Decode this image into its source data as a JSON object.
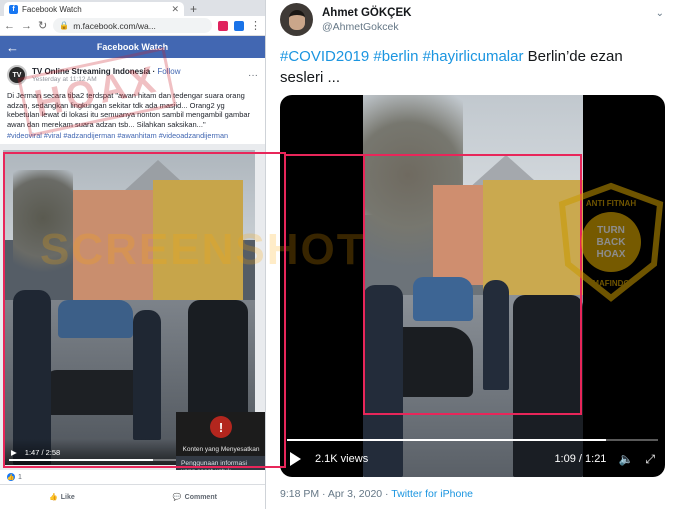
{
  "facebook": {
    "tab_title": "Facebook Watch",
    "url": "m.facebook.com/wa...",
    "header_title": "Facebook Watch",
    "post": {
      "page_name": "TV Online Streaming Indonesia",
      "follow_label": "Follow",
      "timestamp": "Yesterday at 11:12 AM",
      "text": "Di Jerman secara tiba2 terdspat \"awan hitam dan tedengar suara orang adzan, sedangkan lingkungan sekitar tdk ada masjid... Orang2 yg kebetulan lewat di lokasi itu semuanya nonton sambil mengambil gambar awan dan merekam suara adzan tsb... Silahkan saksikan...\"",
      "hashtags": "#videoviral #viral #adzandijerman #awanhitam #videoadzandijerman"
    },
    "video": {
      "time": "1:47 / 2:58",
      "progress": 0.6
    },
    "warning": {
      "title": "Konten yang Menyesatkan",
      "description": "Penggunaan informasi yang sesat untuk membingkai sebuah isu atau individu"
    },
    "reactions_count": "1",
    "like_label": "Like",
    "comment_label": "Comment"
  },
  "tweet": {
    "name": "Ahmet GÖKÇEK",
    "handle": "@AhmetGokcek",
    "hashtags": "#COVID2019 #berlin #hayirlicumalar",
    "text": " Berlin’de ezan sesleri ...",
    "views": "2.1K views",
    "time": "1:09 / 1:21",
    "progress": 0.86,
    "footer_time": "9:18 PM · Apr 3, 2020 · ",
    "footer_source": "Twitter for iPhone"
  },
  "overlay": {
    "stamp": "HOAX",
    "badge_top": "ANTI FITNAH",
    "badge_mid_1": "TURN",
    "badge_mid_2": "BACK",
    "badge_mid_3": "HOAX",
    "badge_bottom": "MAFINDO",
    "watermark": "SCREENSHOT",
    "accent_color": "#e8265a"
  }
}
